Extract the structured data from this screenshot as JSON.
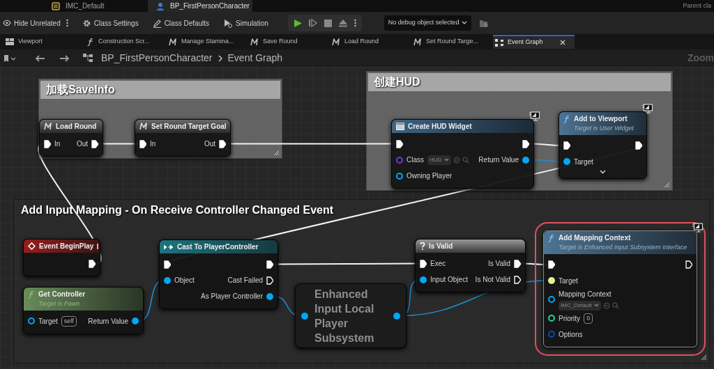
{
  "editor_tabs": [
    {
      "label": "IMC_Default",
      "kind": "asset",
      "selected": false
    },
    {
      "label": "BP_FirstPersonCharacter",
      "kind": "blueprint",
      "selected": true
    }
  ],
  "parent_class_label": "Parent cla",
  "toolbar": {
    "buttons": [
      {
        "label": "Hide Unrelated",
        "kind": "eye"
      },
      {
        "label": "Class Settings",
        "kind": "gear"
      },
      {
        "label": "Class Defaults",
        "kind": "defaults"
      },
      {
        "label": "Simulation",
        "kind": "simulation"
      }
    ],
    "debug_object": "No debug object selected"
  },
  "graph_tabs": [
    {
      "label": "Viewport",
      "kind": "viewport",
      "selected": false
    },
    {
      "label": "Construction Scr...",
      "kind": "function",
      "selected": false
    },
    {
      "label": "Manage Stamina...",
      "kind": "macro",
      "selected": false
    },
    {
      "label": "Save Round",
      "kind": "macro",
      "selected": false
    },
    {
      "label": "Load Round",
      "kind": "macro",
      "selected": false
    },
    {
      "label": "Set Round Targe...",
      "kind": "macro",
      "selected": false
    },
    {
      "label": "Event Graph",
      "kind": "graph",
      "selected": true
    }
  ],
  "breadcrumb": [
    "BP_FirstPersonCharacter",
    "Event Graph"
  ],
  "zoom_label": "Zoom",
  "comments": [
    {
      "title": "加载SaveInfo",
      "kind": "group"
    },
    {
      "title": "创建HUD",
      "kind": "group"
    },
    {
      "title": "Add Input Mapping - On Receive Controller Changed Event",
      "kind": "section"
    }
  ],
  "nodes": [
    {
      "title": "Load Round",
      "kind": "macro",
      "selected": false,
      "rows": [
        {
          "left": {
            "label": "In",
            "kind": "exec",
            "connected": true
          },
          "right": {
            "label": "Out",
            "kind": "exec",
            "connected": true
          }
        }
      ]
    },
    {
      "title": "Set Round Target Goal",
      "kind": "macro",
      "selected": false,
      "rows": [
        {
          "left": {
            "label": "In",
            "kind": "exec",
            "connected": true
          },
          "right": {
            "label": "Out",
            "kind": "exec",
            "connected": true
          }
        }
      ]
    },
    {
      "title": "Create HUD Widget",
      "kind": "widget",
      "selected": false,
      "corner_icon": true,
      "rows": [
        {
          "left": {
            "kind": "exec",
            "connected": true
          },
          "right": {
            "kind": "exec",
            "connected": true
          }
        },
        {
          "left": {
            "label": "Class",
            "kind": "class",
            "connected": false,
            "field": {
              "kind": "asset",
              "value": "HUD"
            }
          },
          "right": {
            "label": "Return Value",
            "kind": "object",
            "connected": true
          }
        },
        {
          "left": {
            "label": "Owning Player",
            "kind": "object",
            "connected": false
          }
        }
      ]
    },
    {
      "title": "Add to Viewport",
      "subtitle": "Target is User Widget",
      "kind": "function",
      "selected": false,
      "corner_icon": true,
      "more_pins": true,
      "rows": [
        {
          "left": {
            "kind": "exec",
            "connected": true
          },
          "right": {
            "kind": "exec",
            "connected": true
          }
        },
        {
          "left": {
            "label": "Target",
            "kind": "object",
            "connected": true
          }
        }
      ]
    },
    {
      "title": "Event BeginPlay",
      "kind": "event",
      "selected": false,
      "rows": [
        {
          "right": {
            "kind": "exec",
            "connected": true
          }
        }
      ]
    },
    {
      "title": "Get Controller",
      "subtitle": "Target is Pawn",
      "kind": "pure",
      "selected": false,
      "rows": [
        {
          "left": {
            "label": "Target",
            "kind": "object",
            "connected": false,
            "field": {
              "kind": "text",
              "value": "self"
            }
          },
          "right": {
            "label": "Return Value",
            "kind": "object",
            "connected": true
          }
        }
      ]
    },
    {
      "title": "Cast To PlayerController",
      "kind": "cast",
      "selected": false,
      "rows": [
        {
          "left": {
            "kind": "exec",
            "connected": true
          },
          "right": {
            "kind": "exec",
            "connected": true
          }
        },
        {
          "left": {
            "label": "Object",
            "kind": "object",
            "connected": true
          },
          "right": {
            "label": "Cast Failed",
            "kind": "exec",
            "connected": false
          }
        },
        {
          "right": {
            "label": "As Player Controller",
            "kind": "object",
            "connected": true
          }
        }
      ]
    },
    {
      "title": "Enhanced Input Local Player Subsystem",
      "kind": "compact",
      "selected": false,
      "rows": [
        {
          "left": {
            "kind": "object",
            "connected": true
          },
          "right": {
            "kind": "object",
            "connected": true
          }
        }
      ]
    },
    {
      "title": "Is Valid",
      "kind": "utility",
      "selected": false,
      "rows": [
        {
          "left": {
            "label": "Exec",
            "kind": "exec",
            "connected": true
          },
          "right": {
            "label": "Is Valid",
            "kind": "exec",
            "connected": true
          }
        },
        {
          "left": {
            "label": "Input Object",
            "kind": "object",
            "connected": true
          },
          "right": {
            "label": "Is Not Valid",
            "kind": "exec",
            "connected": false
          }
        }
      ]
    },
    {
      "title": "Add Mapping Context",
      "subtitle": "Target is Enhanced Input Subsystem Interface",
      "kind": "function",
      "selected": true,
      "corner_icon": true,
      "rows": [
        {
          "left": {
            "kind": "exec",
            "connected": true
          },
          "right": {
            "kind": "exec",
            "connected": false
          }
        },
        {
          "left": {
            "label": "Target",
            "kind": "interface",
            "connected": true
          }
        },
        {
          "left": {
            "label": "Mapping Context",
            "kind": "object",
            "connected": false,
            "wrapped": true,
            "field": {
              "kind": "asset",
              "value": "IMC_Default"
            }
          }
        },
        {
          "left": {
            "label": "Priority",
            "kind": "int",
            "connected": false,
            "field": {
              "kind": "text",
              "value": "0"
            }
          }
        },
        {
          "left": {
            "label": "Options",
            "kind": "struct",
            "connected": false
          }
        }
      ]
    }
  ]
}
